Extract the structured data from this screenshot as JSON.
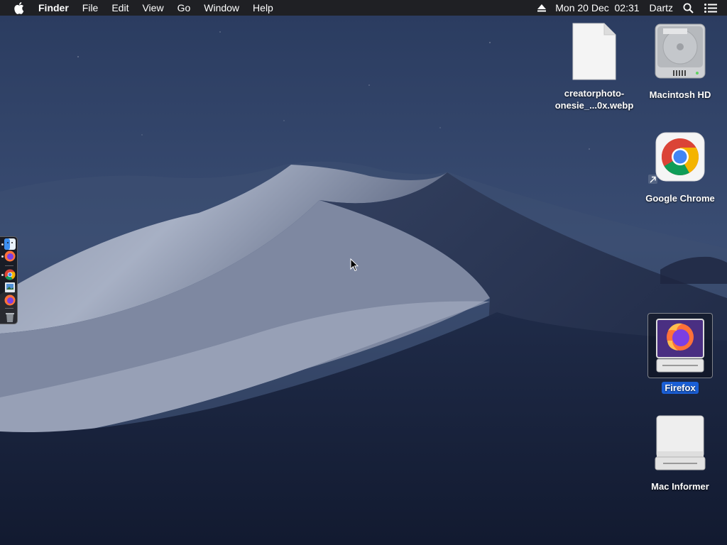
{
  "menubar": {
    "apple_icon": "apple-logo-icon",
    "app_name": "Finder",
    "menus": [
      "File",
      "Edit",
      "View",
      "Go",
      "Window",
      "Help"
    ],
    "eject_icon": "eject-icon",
    "datetime": "Mon 20 Dec  02:31",
    "user": "Dartz",
    "search_icon": "spotlight-search-icon",
    "control_icon": "notification-center-icon"
  },
  "desktop": {
    "icons": [
      {
        "line1": "creatorphoto-",
        "line2": "onesie_...0x.webp",
        "icon": "document-icon"
      },
      {
        "label": "Macintosh HD",
        "icon": "hard-drive-icon"
      },
      {
        "label": "Google Chrome",
        "icon": "chrome-alias-icon"
      },
      {
        "label": "Firefox",
        "icon": "firefox-volume-icon",
        "selected": true
      },
      {
        "label": "Mac Informer",
        "icon": "external-drive-icon"
      }
    ]
  },
  "dock": {
    "apps": [
      "finder-icon",
      "firefox-icon",
      "chrome-icon",
      "preview-icon",
      "firefox-icon",
      "trash-icon"
    ]
  },
  "colors": {
    "menubar_bg": "#1e1e20",
    "selection": "#1a5fd6",
    "sky": "#2b3d63"
  }
}
